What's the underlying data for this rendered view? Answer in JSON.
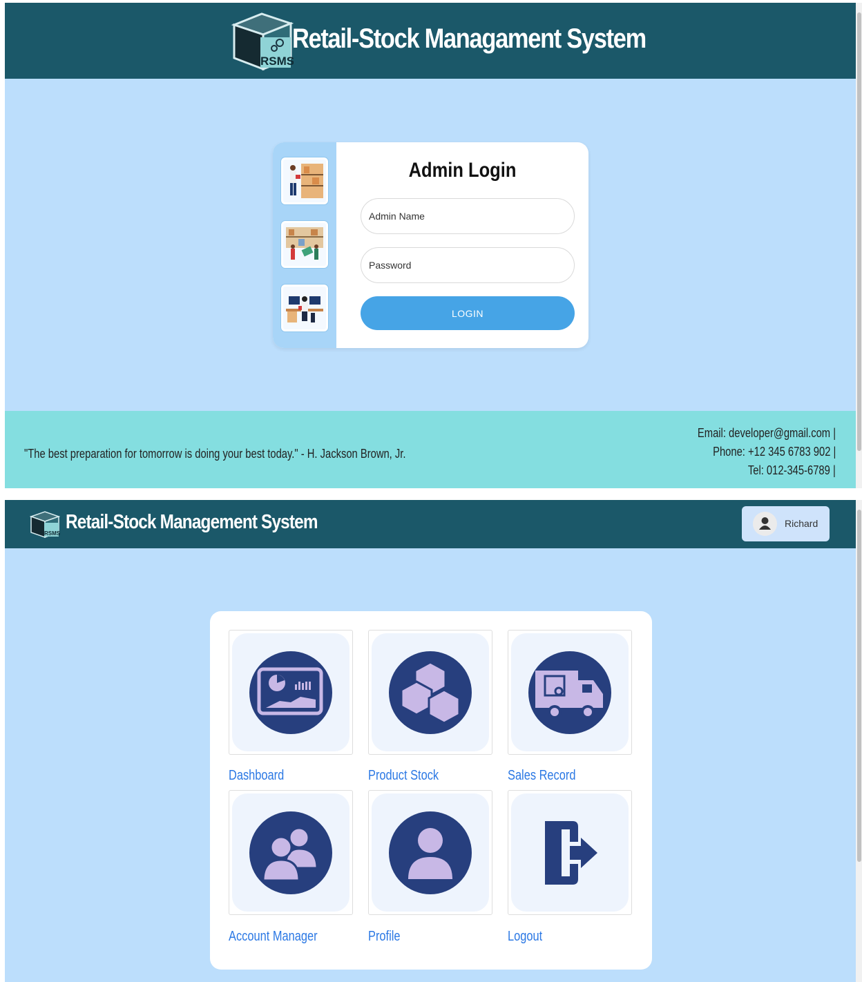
{
  "login_screen": {
    "header": {
      "title": "Retail-Stock Managament System",
      "logo_text": "RSMS"
    },
    "card": {
      "title": "Admin Login",
      "admin_name_placeholder": "Admin Name",
      "admin_name_value": "",
      "password_placeholder": "Password",
      "password_value": "",
      "login_label": "LOGIN"
    },
    "footer": {
      "quote": "\"The best preparation for tomorrow is doing your best today.\" - H. Jackson Brown, Jr.",
      "email": "Email: developer@gmail.com |",
      "phone": "Phone: +12 345 6783 902 |",
      "tel": "Tel: 012-345-6789 |"
    }
  },
  "menu_screen": {
    "header": {
      "title": "Retail-Stock Management System",
      "logo_text": "RSMS"
    },
    "user": {
      "name": "Richard"
    },
    "tiles": [
      {
        "label": "Dashboard",
        "icon": "dashboard-icon"
      },
      {
        "label": "Product Stock",
        "icon": "boxes-icon"
      },
      {
        "label": "Sales Record",
        "icon": "delivery-truck-icon"
      },
      {
        "label": "Account Manager",
        "icon": "users-icon"
      },
      {
        "label": "Profile",
        "icon": "user-icon"
      },
      {
        "label": "Logout",
        "icon": "logout-door-icon"
      }
    ]
  },
  "colors": {
    "header": "#1b5869",
    "page_bg": "#bcdefc",
    "footer": "#84dee0",
    "login_button": "#46a4e6",
    "tile_circle": "#273f7e",
    "tile_glyph": "#c8b8e6",
    "link": "#2b78e4"
  }
}
